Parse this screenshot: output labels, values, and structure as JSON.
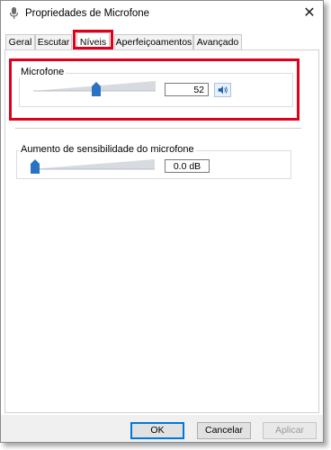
{
  "window": {
    "title": "Propriedades de Microfone"
  },
  "tabs": [
    {
      "label": "Geral"
    },
    {
      "label": "Escutar"
    },
    {
      "label": "Níveis"
    },
    {
      "label": "Aperfeiçoamentos"
    },
    {
      "label": "Avançado"
    }
  ],
  "active_tab": "Níveis",
  "microphone": {
    "label": "Microfone",
    "value": "52",
    "level_percent": 52
  },
  "boost": {
    "label": "Aumento de sensibilidade do microfone",
    "value": "0.0 dB",
    "level_percent": 0
  },
  "buttons": {
    "ok": "OK",
    "cancel": "Cancelar",
    "apply": "Aplicar"
  },
  "colors": {
    "highlight": "#e0001b",
    "accent": "#0078d7",
    "thumb": "#2a73c4"
  },
  "icons": {
    "title": "microphone-icon",
    "close": "close-icon",
    "speaker": "speaker-icon"
  }
}
